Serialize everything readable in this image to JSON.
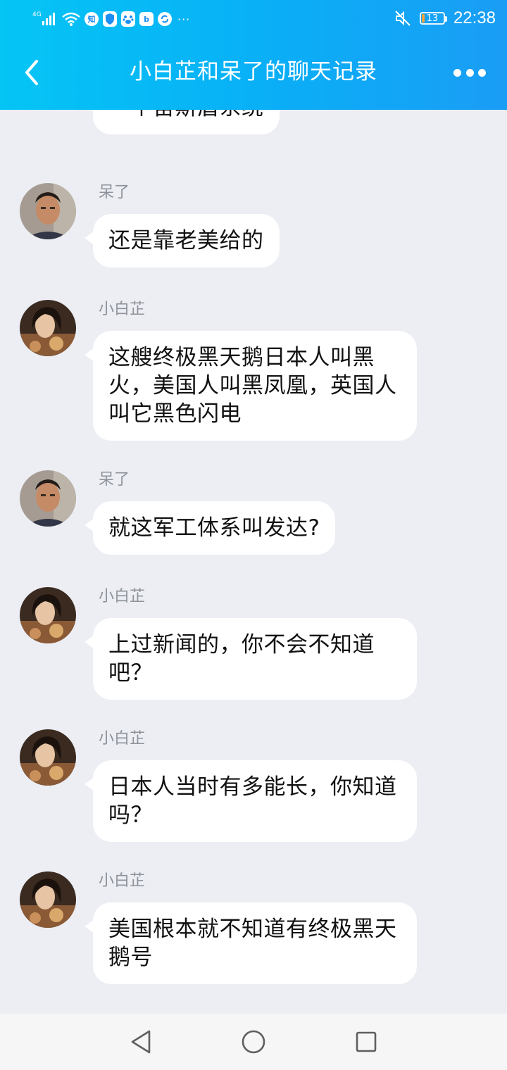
{
  "status_bar": {
    "network": "4G",
    "app_badges": [
      "知",
      "b"
    ],
    "more_indicator": "···",
    "battery": "13",
    "time": "22:38",
    "icons": [
      "signal-icon",
      "wifi-icon",
      "zhihu-icon",
      "shield-icon",
      "baidu-icon",
      "bilibili-icon",
      "sync-icon",
      "mute-icon",
      "battery-icon"
    ]
  },
  "header": {
    "title": "小白芷和呆了的聊天记录",
    "back_icon": "chevron-left-icon",
    "more_icon": "more-dots-icon"
  },
  "colors": {
    "header_gradient_start": "#05c5f5",
    "header_gradient_end": "#1a9df5",
    "chat_background": "#eceef4",
    "bubble": "#ffffff",
    "sender_name": "#8d9199"
  },
  "messages": [
    {
      "sender": "",
      "avatar": "man",
      "text": "一个宙斯盾系统"
    },
    {
      "sender": "呆了",
      "avatar": "man",
      "text": "还是靠老美给的"
    },
    {
      "sender": "小白芷",
      "avatar": "woman",
      "text": "这艘终极黑天鹅日本人叫黑火，美国人叫黑凤凰，英国人叫它黑色闪电"
    },
    {
      "sender": "呆了",
      "avatar": "man",
      "text": "就这军工体系叫发达?"
    },
    {
      "sender": "小白芷",
      "avatar": "woman",
      "text": "上过新闻的，你不会不知道吧？"
    },
    {
      "sender": "小白芷",
      "avatar": "woman",
      "text": "日本人当时有多能长，你知道吗？"
    },
    {
      "sender": "小白芷",
      "avatar": "woman",
      "text": "美国根本就不知道有终极黑天鹅号"
    }
  ],
  "nav_bar": {
    "icons": [
      "back-triangle-icon",
      "home-circle-icon",
      "recents-square-icon"
    ]
  }
}
